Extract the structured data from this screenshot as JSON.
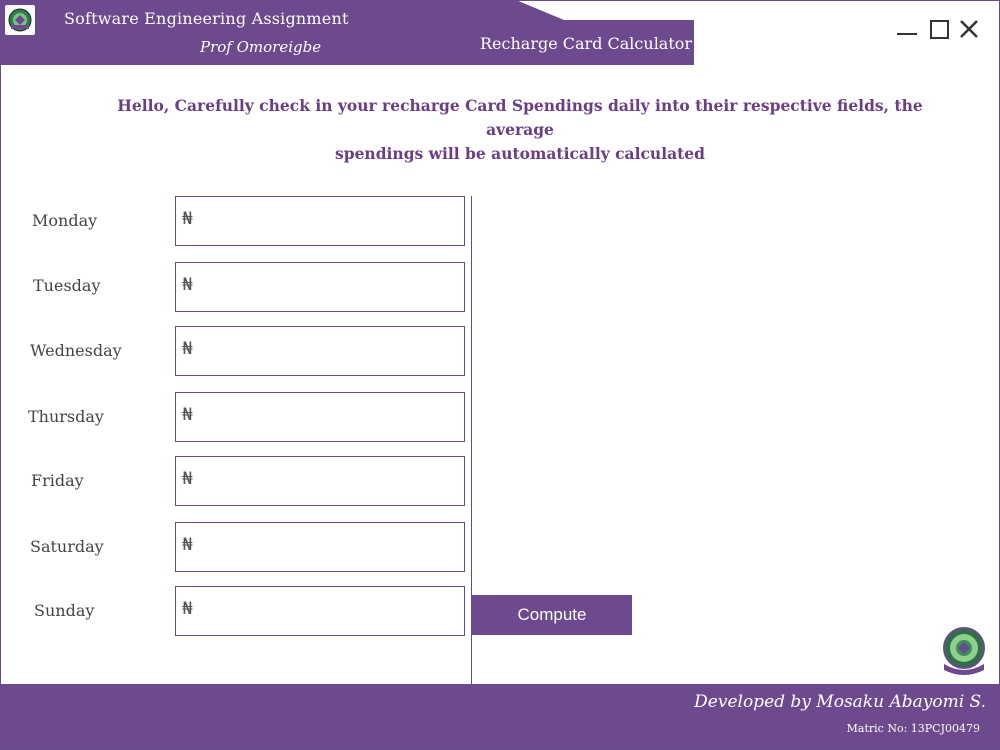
{
  "header": {
    "title": "Software Engineering Assignment",
    "subtitle": "Prof Omoreigbe",
    "app_name": "Recharge Card Calculator",
    "logo_icon": "university-crest-icon"
  },
  "window_controls": {
    "minimize_icon": "minimize-icon",
    "maximize_icon": "maximize-icon",
    "close_icon": "close-icon"
  },
  "instructions": {
    "line1": "Hello, Carefully check in your recharge Card Spendings daily into their respective fields, the average",
    "line2": "spendings will be automatically calculated"
  },
  "currency_symbol": "₦",
  "days": [
    {
      "label": "Monday",
      "value": ""
    },
    {
      "label": "Tuesday",
      "value": ""
    },
    {
      "label": "Wednesday",
      "value": ""
    },
    {
      "label": "Thursday",
      "value": ""
    },
    {
      "label": "Friday",
      "value": ""
    },
    {
      "label": "Saturday",
      "value": ""
    },
    {
      "label": "Sunday",
      "value": ""
    }
  ],
  "compute_button": "Compute",
  "footer": {
    "developer": "Developed by Mosaku Abayomi S.",
    "matric": "Matric No: 13PCJ00479"
  },
  "colors": {
    "brand_purple": "#6c4a8d",
    "text_purple": "#6b3d86"
  }
}
